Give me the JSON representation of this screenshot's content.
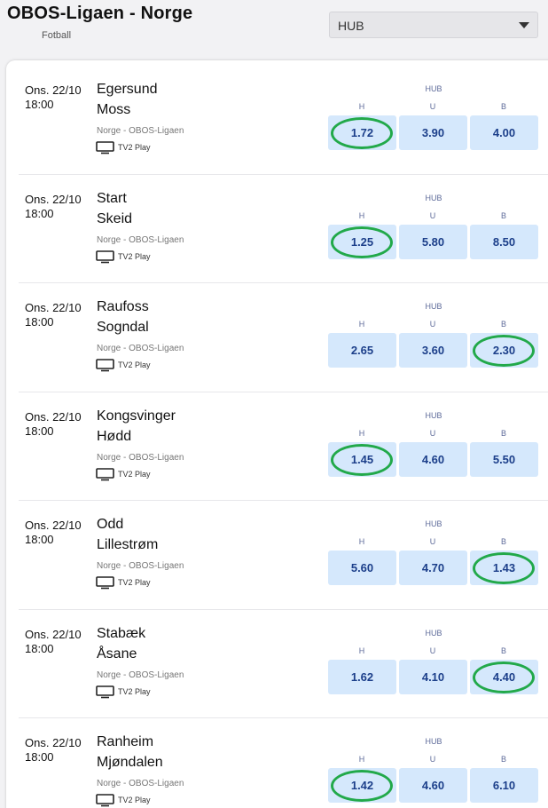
{
  "header": {
    "title": "OBOS-Ligaen - Norge",
    "subtitle": "Fotball",
    "market_select": {
      "selected": "HUB"
    }
  },
  "market_heading": "HUB",
  "outcome_labels": {
    "home": "H",
    "draw": "U",
    "away": "B"
  },
  "colors": {
    "odds_bg": "#d5e8fc",
    "odds_text": "#1c3f8a",
    "highlight": "#22a94a"
  },
  "matches": [
    {
      "date": "Ons. 22/10",
      "time": "18:00",
      "home": "Egersund",
      "away": "Moss",
      "league": "Norge - OBOS-Ligaen",
      "tv": "TV2 Play",
      "odds": {
        "h": "1.72",
        "u": "3.90",
        "b": "4.00"
      },
      "highlighted": "h"
    },
    {
      "date": "Ons. 22/10",
      "time": "18:00",
      "home": "Start",
      "away": "Skeid",
      "league": "Norge - OBOS-Ligaen",
      "tv": "TV2 Play",
      "odds": {
        "h": "1.25",
        "u": "5.80",
        "b": "8.50"
      },
      "highlighted": "h"
    },
    {
      "date": "Ons. 22/10",
      "time": "18:00",
      "home": "Raufoss",
      "away": "Sogndal",
      "league": "Norge - OBOS-Ligaen",
      "tv": "TV2 Play",
      "odds": {
        "h": "2.65",
        "u": "3.60",
        "b": "2.30"
      },
      "highlighted": "b"
    },
    {
      "date": "Ons. 22/10",
      "time": "18:00",
      "home": "Kongsvinger",
      "away": "Hødd",
      "league": "Norge - OBOS-Ligaen",
      "tv": "TV2 Play",
      "odds": {
        "h": "1.45",
        "u": "4.60",
        "b": "5.50"
      },
      "highlighted": "h"
    },
    {
      "date": "Ons. 22/10",
      "time": "18:00",
      "home": "Odd",
      "away": "Lillestrøm",
      "league": "Norge - OBOS-Ligaen",
      "tv": "TV2 Play",
      "odds": {
        "h": "5.60",
        "u": "4.70",
        "b": "1.43"
      },
      "highlighted": "b"
    },
    {
      "date": "Ons. 22/10",
      "time": "18:00",
      "home": "Stabæk",
      "away": "Åsane",
      "league": "Norge - OBOS-Ligaen",
      "tv": "TV2 Play",
      "odds": {
        "h": "1.62",
        "u": "4.10",
        "b": "4.40"
      },
      "highlighted": "b"
    },
    {
      "date": "Ons. 22/10",
      "time": "18:00",
      "home": "Ranheim",
      "away": "Mjøndalen",
      "league": "Norge - OBOS-Ligaen",
      "tv": "TV2 Play",
      "odds": {
        "h": "1.42",
        "u": "4.60",
        "b": "6.10"
      },
      "highlighted": "h"
    }
  ]
}
